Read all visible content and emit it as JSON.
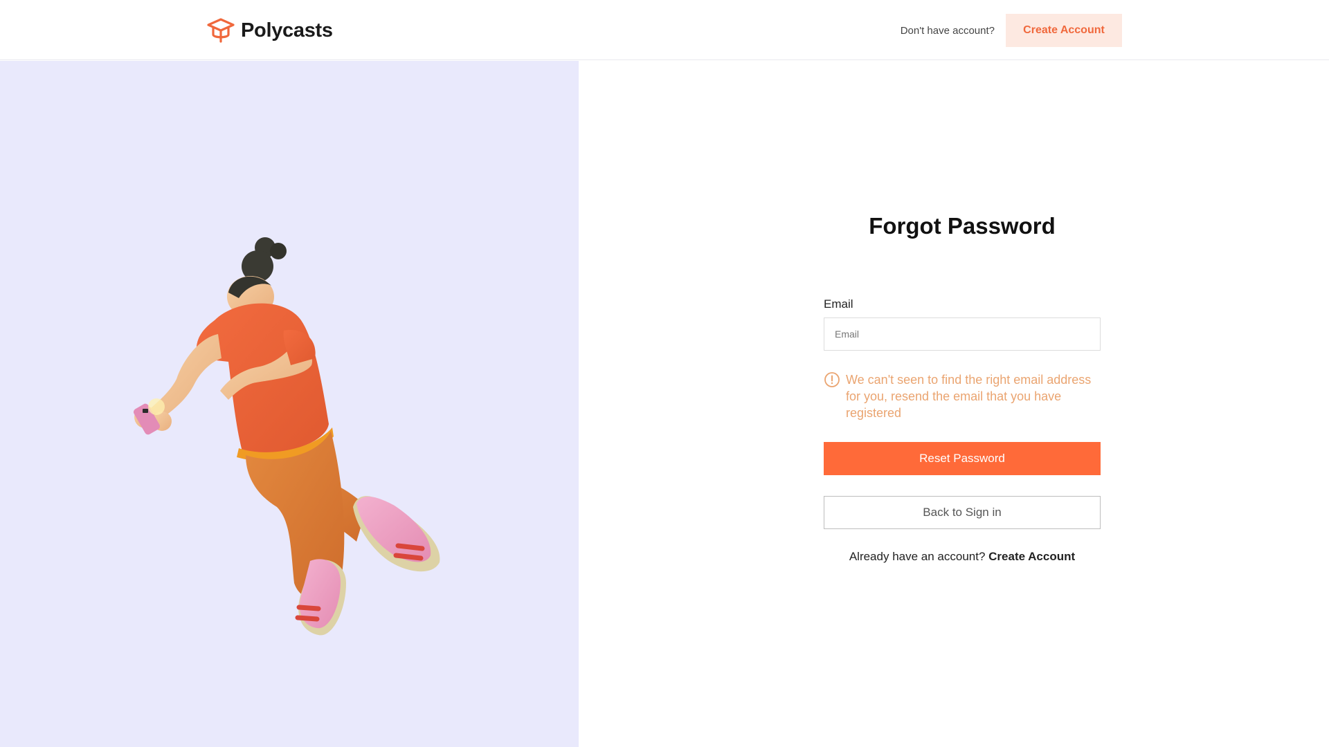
{
  "header": {
    "brand_name": "Polycasts",
    "logo_icon": "graduation-cap-icon",
    "prompt": "Don't have account?",
    "create_account_label": "Create Account"
  },
  "illustration": {
    "icon": "person-with-phone-illustration"
  },
  "form": {
    "title": "Forgot Password",
    "email_label": "Email",
    "email_placeholder": "Email",
    "email_value": "",
    "error_icon": "alert-circle-icon",
    "error_message": "We can't seen to find the right email address for you, resend the email that you have registered",
    "reset_label": "Reset Password",
    "back_label": "Back to Sign in",
    "footer_prompt": "Already have an account?",
    "footer_link": "Create Account"
  },
  "colors": {
    "accent": "#ff6a39",
    "accent_light": "#fde9e1",
    "error": "#eaa470",
    "panel_bg": "#e9e9fc"
  }
}
